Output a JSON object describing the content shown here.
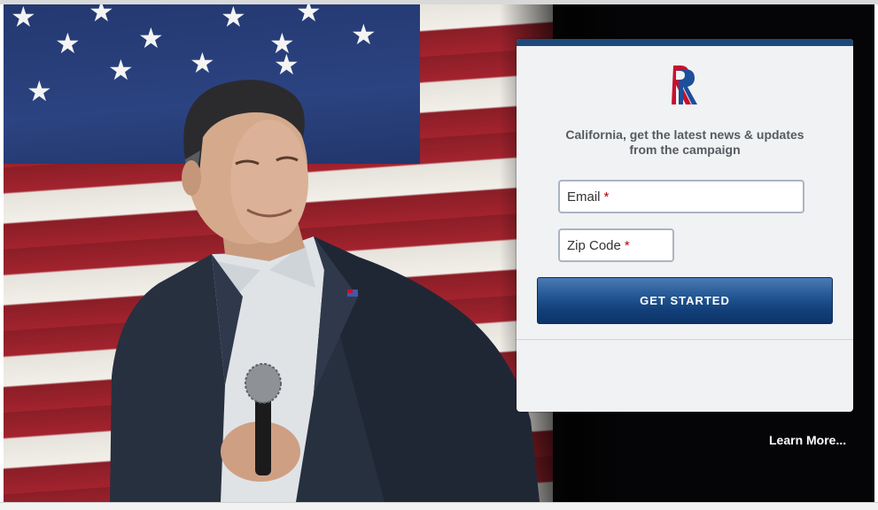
{
  "form": {
    "headline": "California, get the latest news & updates from the campaign",
    "email_label": "Email",
    "zip_label": "Zip Code",
    "required_mark": "*",
    "submit_label": "GET STARTED"
  },
  "links": {
    "learn_more": "Learn More..."
  },
  "icons": {
    "logo": "romney-r-logo-icon",
    "flag": "us-flag"
  },
  "colors": {
    "button": "#12407a",
    "card_accent": "#1d4a7a",
    "logo_red": "#c8102e",
    "logo_blue": "#1e4f9a",
    "required": "#b30000"
  }
}
